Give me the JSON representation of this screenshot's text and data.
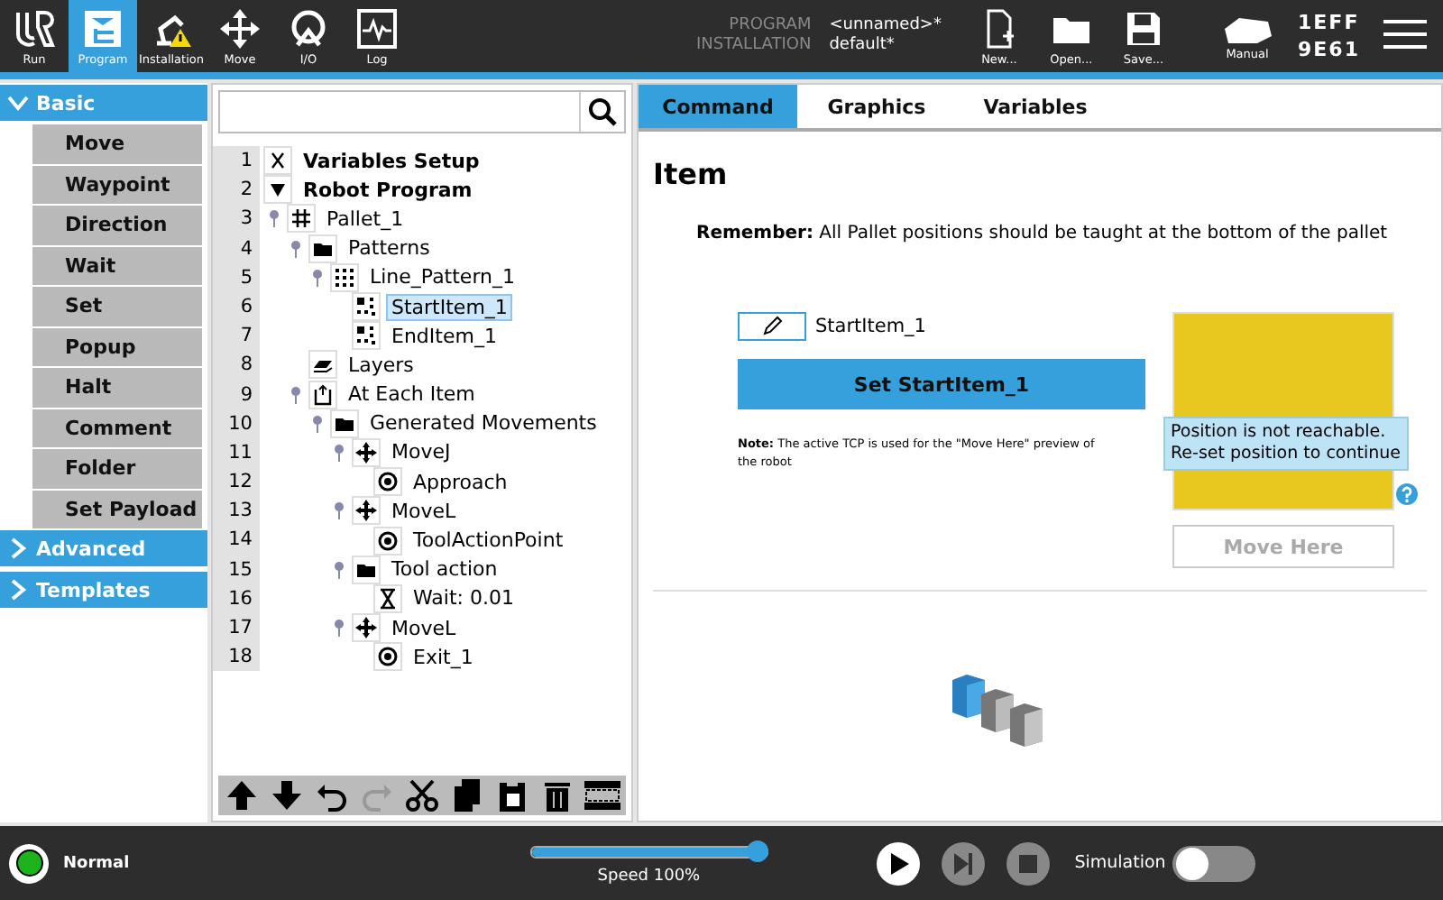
{
  "top_bar": {
    "nav": [
      {
        "label": "Run",
        "kind": "logo",
        "selected": false
      },
      {
        "label": "Program",
        "kind": "program",
        "selected": true
      },
      {
        "label": "Installation",
        "kind": "installation",
        "selected": false
      },
      {
        "label": "Move",
        "kind": "move",
        "selected": false
      },
      {
        "label": "I/O",
        "kind": "io",
        "selected": false
      },
      {
        "label": "Log",
        "kind": "log",
        "selected": false
      }
    ],
    "program_label": "PROGRAM",
    "program_value": "<unnamed>*",
    "installation_label": "INSTALLATION",
    "installation_value": "default*",
    "file_actions": [
      {
        "label": "New...",
        "kind": "new"
      },
      {
        "label": "Open...",
        "kind": "open"
      },
      {
        "label": "Save...",
        "kind": "save"
      }
    ],
    "mode_label": "Manual",
    "device_id": [
      "1EFF",
      "9E61"
    ]
  },
  "sidebar": {
    "categories": [
      {
        "label": "Basic",
        "expanded": true,
        "items": [
          "Move",
          "Waypoint",
          "Direction",
          "Wait",
          "Set",
          "Popup",
          "Halt",
          "Comment",
          "Folder",
          "Set Payload"
        ]
      },
      {
        "label": "Advanced",
        "expanded": false
      },
      {
        "label": "Templates",
        "expanded": false
      }
    ]
  },
  "program_tree": {
    "nodes": [
      {
        "line": "1",
        "label": "Variables Setup",
        "kind": "variable",
        "selected": false
      },
      {
        "line": "2",
        "label": "Robot Program",
        "kind": "triangle",
        "selected": false,
        "children": [
          {
            "line": "3",
            "label": "Pallet_1",
            "kind": "pallet",
            "selected": false,
            "children": [
              {
                "line": "4",
                "label": "Patterns",
                "kind": "folder",
                "selected": false,
                "children": [
                  {
                    "line": "5",
                    "label": "Line_Pattern_1",
                    "kind": "pattern",
                    "selected": false,
                    "children": [
                      {
                        "line": "6",
                        "label": "StartItem_1",
                        "kind": "item",
                        "selected": true
                      },
                      {
                        "line": "7",
                        "label": "EndItem_1",
                        "kind": "item",
                        "selected": false
                      }
                    ]
                  }
                ]
              },
              {
                "line": "8",
                "label": "Layers",
                "kind": "layers",
                "selected": false
              },
              {
                "line": "9",
                "label": "At Each Item",
                "kind": "each",
                "selected": false,
                "children": [
                  {
                    "line": "10",
                    "label": "Generated Movements",
                    "kind": "folder",
                    "selected": false,
                    "children": [
                      {
                        "line": "11",
                        "label": "MoveJ",
                        "kind": "move",
                        "selected": false,
                        "children": [
                          {
                            "line": "12",
                            "label": "Approach",
                            "kind": "waypoint",
                            "selected": false
                          }
                        ]
                      },
                      {
                        "line": "13",
                        "label": "MoveL",
                        "kind": "move",
                        "selected": false,
                        "children": [
                          {
                            "line": "14",
                            "label": "ToolActionPoint",
                            "kind": "waypoint",
                            "selected": false
                          }
                        ]
                      },
                      {
                        "line": "15",
                        "label": "Tool action",
                        "kind": "folder",
                        "selected": false,
                        "children": [
                          {
                            "line": "16",
                            "label": "Wait: 0.01",
                            "kind": "hourglass",
                            "selected": false
                          }
                        ]
                      },
                      {
                        "line": "17",
                        "label": "MoveL",
                        "kind": "move",
                        "selected": false,
                        "children": [
                          {
                            "line": "18",
                            "label": "Exit_1",
                            "kind": "waypoint",
                            "selected": false
                          }
                        ]
                      }
                    ]
                  }
                ]
              }
            ]
          }
        ]
      }
    ],
    "toolbar": [
      {
        "kind": "up",
        "disabled": false
      },
      {
        "kind": "down",
        "disabled": false
      },
      {
        "kind": "undo",
        "disabled": false
      },
      {
        "kind": "redo",
        "disabled": true
      },
      {
        "kind": "cut",
        "disabled": false
      },
      {
        "kind": "copy",
        "disabled": false
      },
      {
        "kind": "paste",
        "disabled": false
      },
      {
        "kind": "delete",
        "disabled": false
      },
      {
        "kind": "suppress",
        "disabled": false
      }
    ]
  },
  "detail": {
    "tabs": [
      {
        "label": "Command",
        "selected": true
      },
      {
        "label": "Graphics",
        "selected": false
      },
      {
        "label": "Variables",
        "selected": false
      }
    ],
    "title": "Item",
    "remember": "**Remember:** All Pallet positions should be taught at the bottom of the pallet",
    "position_name": "StartItem_1",
    "set_button": "Set StartItem_1",
    "note": "**Note:** The active TCP is used for the \"Move Here\" preview of the robot",
    "tooltip_lines": [
      "Position is not reachable.",
      "Re-set position to continue"
    ],
    "move_here": {
      "label": "Move Here",
      "disabled": true
    }
  },
  "bottom_bar": {
    "status": "Normal",
    "speed": {
      "level": 1.0,
      "label": "Speed 100%"
    },
    "controls": [
      {
        "kind": "play",
        "disabled": false
      },
      {
        "kind": "step",
        "disabled": true
      },
      {
        "kind": "stop",
        "disabled": true
      }
    ],
    "simulation": {
      "label": "Simulation",
      "on": false
    }
  }
}
